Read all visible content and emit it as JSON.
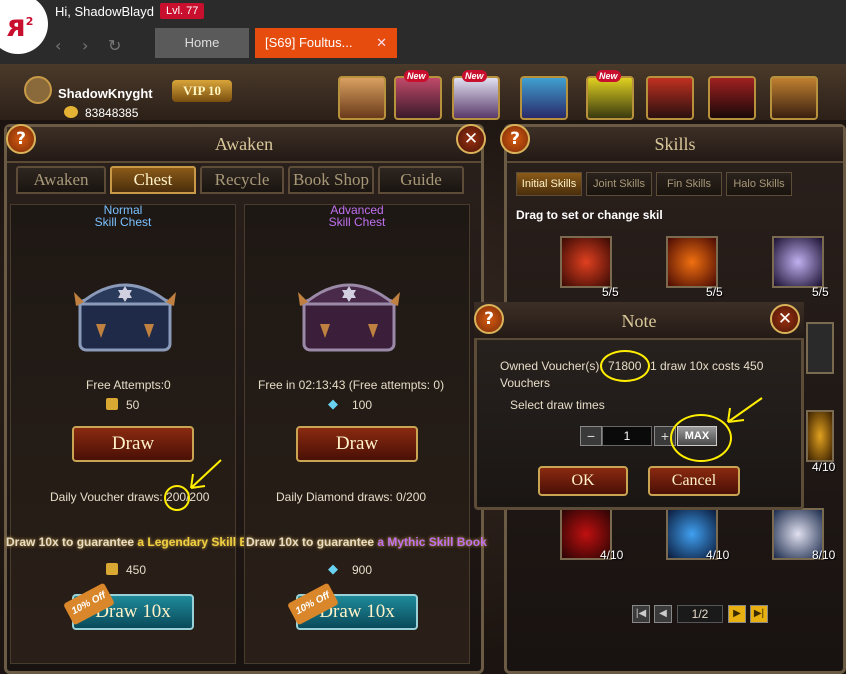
{
  "browser": {
    "greeting": "Hi, ShadowBlayd",
    "level": "Lvl. 77",
    "tab_home": "Home",
    "tab_active": "[S69] Foultus...",
    "tab_close": "✕",
    "back": "‹",
    "forward": "›",
    "reload": "↻"
  },
  "player": {
    "name": "ShadowKnyght",
    "vip": "VIP 10",
    "gold": "83848385"
  },
  "top_icons": {
    "new_label": "New"
  },
  "awaken": {
    "title": "Awaken",
    "help": "?",
    "close": "✕",
    "tabs": [
      "Awaken",
      "Chest",
      "Recycle",
      "Book Shop",
      "Guide"
    ],
    "normal": {
      "title_line1": "Normal",
      "title_line2": "Skill Chest",
      "free_attempts": "Free Attempts:0",
      "cost": "50",
      "draw": "Draw",
      "daily": "Daily Voucher draws: 200/200",
      "guarantee_prefix": "Draw 10x to guarantee",
      "guarantee_item": " a Legendary Skill Boo",
      "cost10": "450",
      "discount": "10% Off",
      "draw10": "Draw 10x"
    },
    "advanced": {
      "title_line1": "Advanced",
      "title_line2": "Skill Chest",
      "free_attempts": "Free in 02:13:43  (Free attempts: 0)",
      "cost": "100",
      "draw": "Draw",
      "daily": "Daily Diamond draws: 0/200",
      "guarantee_prefix": "Draw 10x to guarantee",
      "guarantee_item": " a Mythic Skill Book",
      "cost10": "900",
      "discount": "10% Off",
      "draw10": "Draw 10x"
    }
  },
  "skills": {
    "title": "Skills",
    "help": "?",
    "close": "✕",
    "tabs": [
      "Initial Skills",
      "Joint Skills",
      "Fin Skills",
      "Halo Skills"
    ],
    "instruction": "Drag to set or change skil",
    "counts": [
      "5/5",
      "5/5",
      "5/5",
      "4/10",
      "4/10",
      "4/10",
      "8/10"
    ],
    "page": "1/2"
  },
  "note": {
    "title": "Note",
    "help": "?",
    "close": "✕",
    "owned_label": "Owned Voucher(s):",
    "owned_value": "71800",
    "cost_text": "1 draw 10x costs 450",
    "cost_unit": "Vouchers",
    "select_label": "Select draw times",
    "minus": "−",
    "plus": "+",
    "quantity": "1",
    "max": "MAX",
    "ok": "OK",
    "cancel": "Cancel"
  },
  "colors": {
    "accent_tab": "#e64c0e",
    "legendary": "#f0d040",
    "mythic": "#c070f0",
    "annotation": "#ffee00"
  }
}
